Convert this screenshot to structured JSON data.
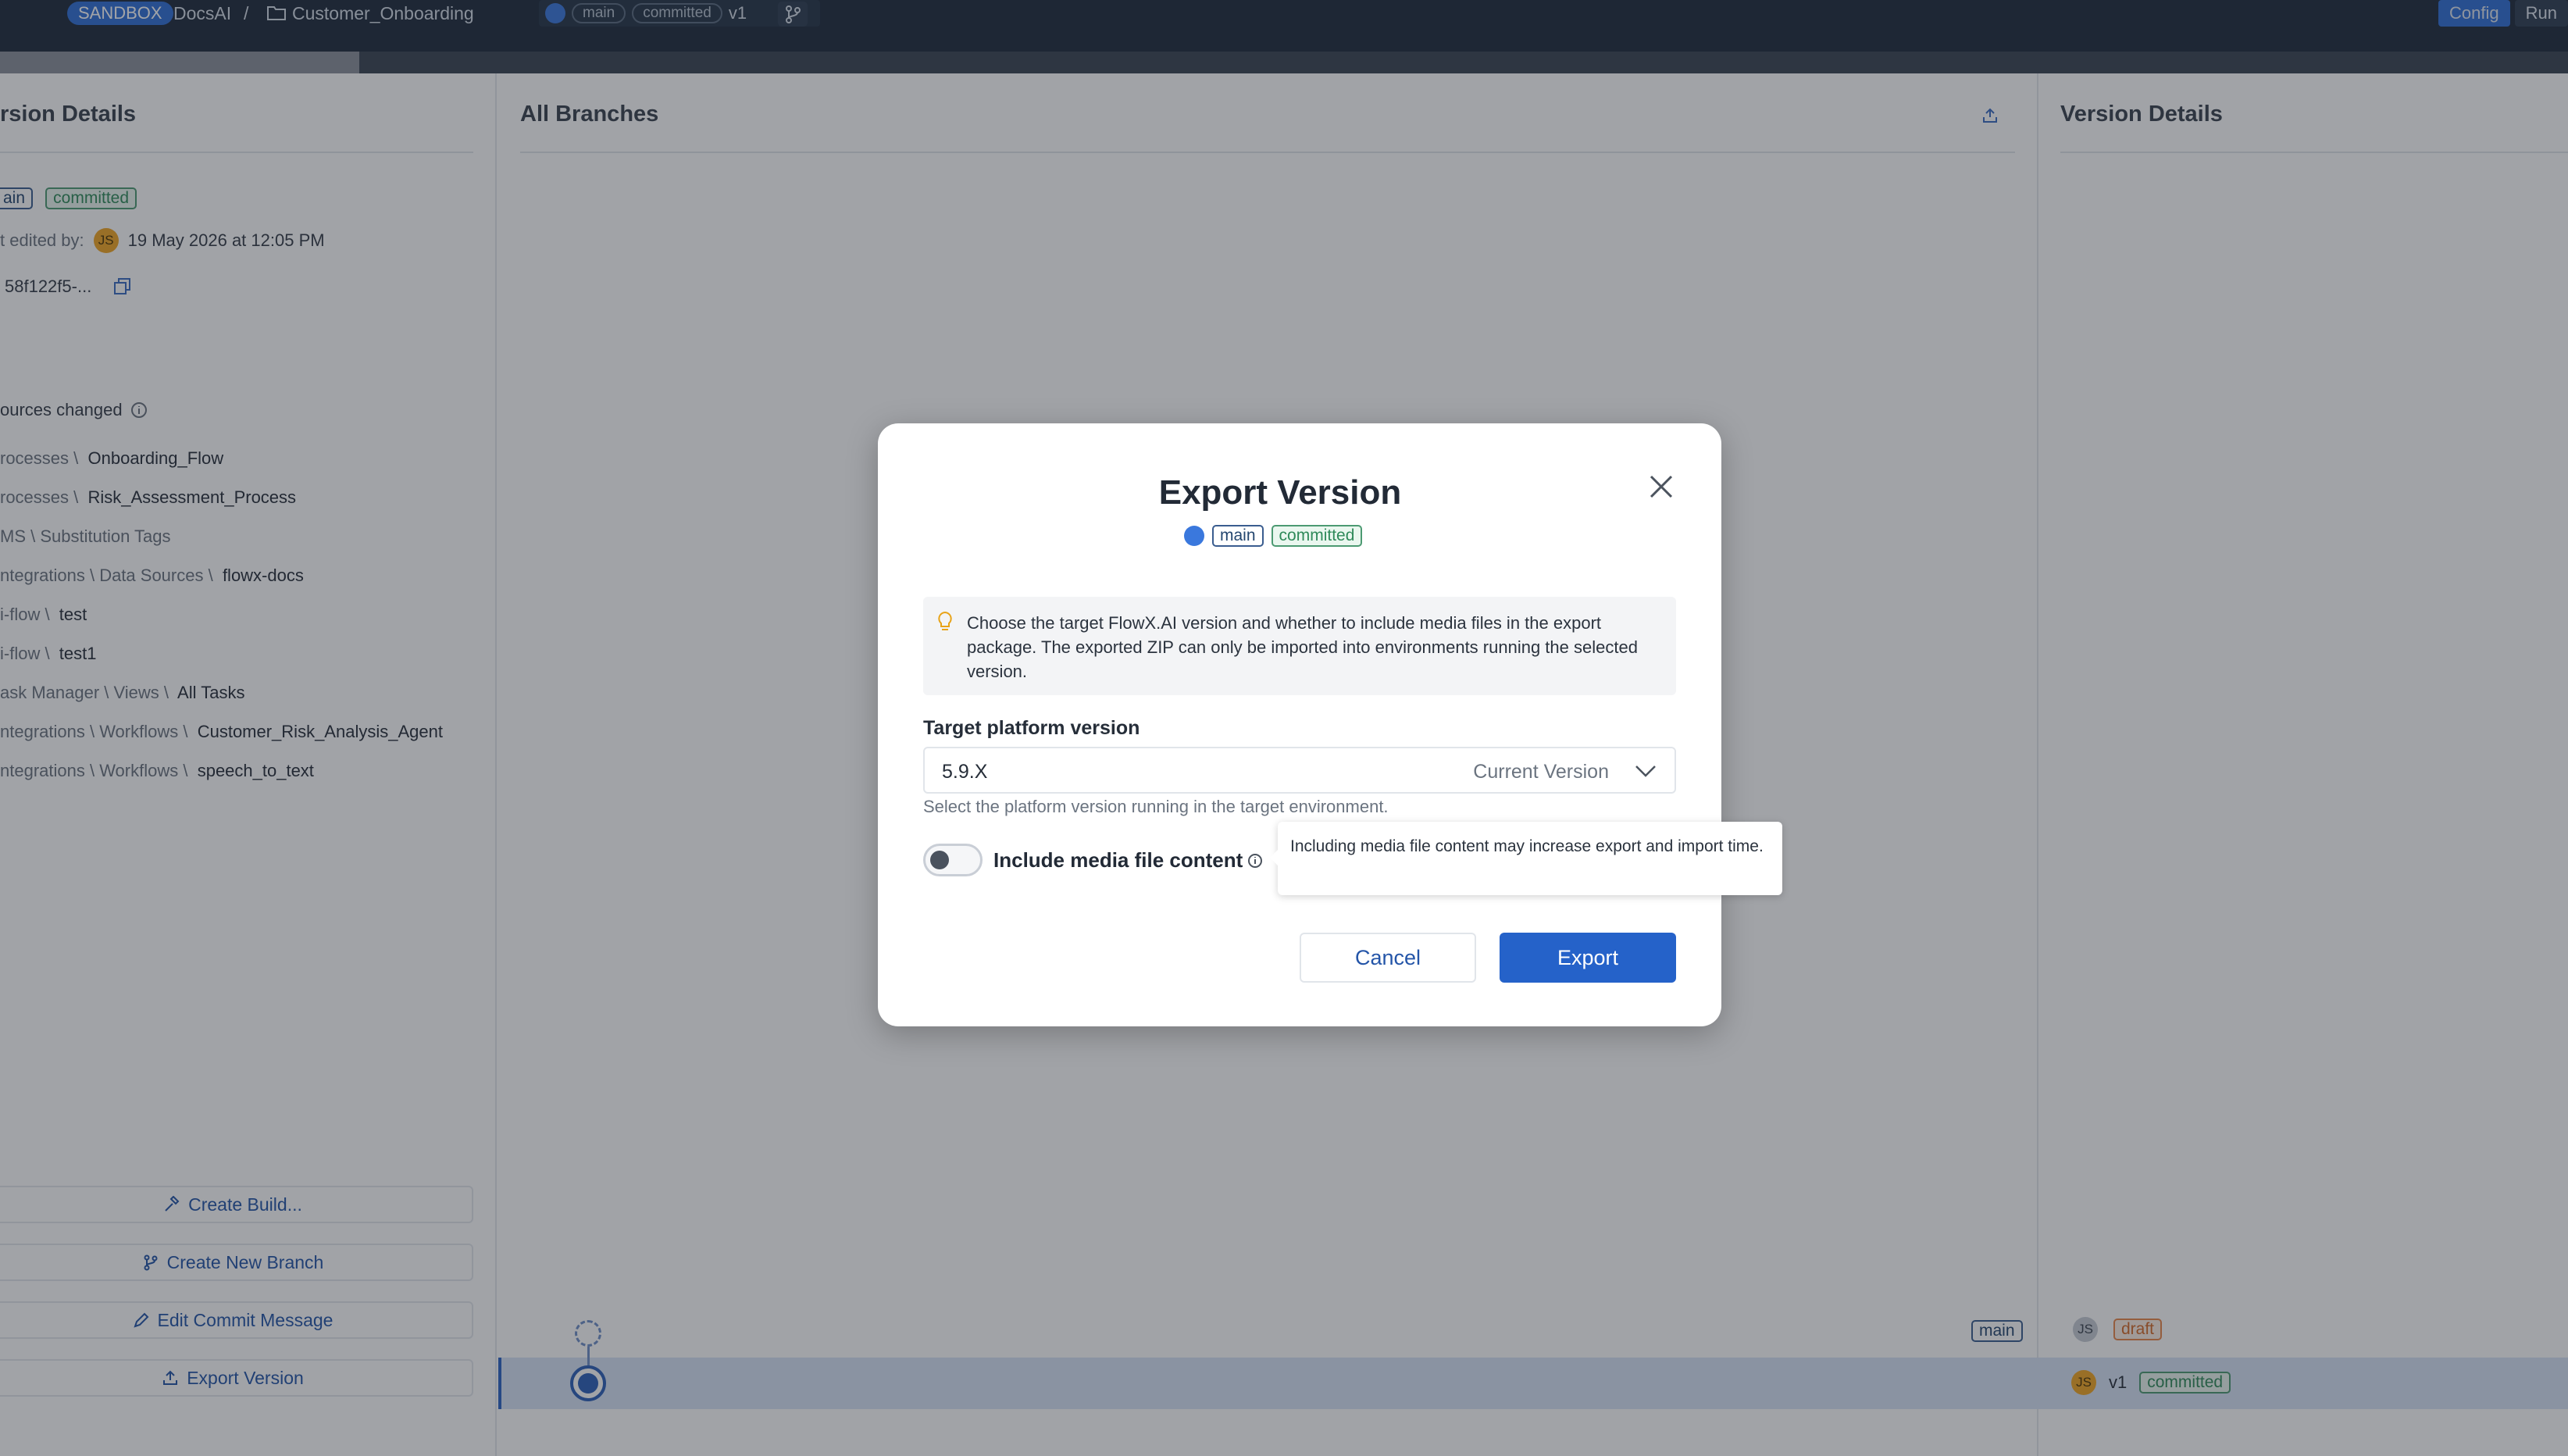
{
  "topbar": {
    "env_badge": "SANDBOX",
    "project": "DocsAI",
    "separator": "/",
    "workspace": "Customer_Onboarding",
    "branch_tag": "main",
    "status_tag": "committed",
    "version": "v1",
    "right_buttons": [
      "Config",
      "Run"
    ]
  },
  "left_panel": {
    "title": "rsion Details",
    "branch_tag": "ain",
    "status_tag": "committed",
    "edited_by_label": "t edited by:",
    "editor_initials": "JS",
    "edited_at": "19 May 2026 at 12:05 PM",
    "commit_hash": "58f122f5-...",
    "resources_label": "ources changed",
    "resources": [
      {
        "path": "rocesses \\",
        "name": "Onboarding_Flow"
      },
      {
        "path": "rocesses \\",
        "name": "Risk_Assessment_Process"
      },
      {
        "path": "MS \\ Substitution Tags",
        "name": ""
      },
      {
        "path": "ntegrations \\ Data Sources \\",
        "name": "flowx-docs"
      },
      {
        "path": "i-flow \\",
        "name": "test"
      },
      {
        "path": "i-flow \\",
        "name": "test1"
      },
      {
        "path": "ask Manager \\ Views \\",
        "name": "All Tasks"
      },
      {
        "path": "ntegrations \\ Workflows \\",
        "name": "Customer_Risk_Analysis_Agent"
      },
      {
        "path": "ntegrations \\ Workflows \\",
        "name": "speech_to_text"
      }
    ],
    "actions": [
      "Create Build...",
      "Create New Branch",
      "Edit Commit Message",
      "Export Version"
    ]
  },
  "middle_panel": {
    "title": "All Branches",
    "graph_branch_tag": "main"
  },
  "right_panel": {
    "title": "Version Details",
    "rows": [
      {
        "initials": "JS",
        "version": "",
        "status": "draft"
      },
      {
        "initials": "JS",
        "version": "v1",
        "status": "committed"
      }
    ]
  },
  "modal": {
    "title": "Export Version",
    "branch_tag": "main",
    "status_tag": "committed",
    "info_text": "Choose the target FlowX.AI version and whether to include media files in the export package. The exported ZIP can only be imported into environments running the selected version.",
    "target_label": "Target platform version",
    "target_value": "5.9.X",
    "target_hint": "Current Version",
    "helper_text": "Select the platform version running in the target environment.",
    "toggle_label": "Include media file content",
    "toggle_on": false,
    "tooltip": "Including media file content may increase export and import time.",
    "cancel_label": "Cancel",
    "export_label": "Export"
  },
  "colors": {
    "primary": "#2562c9",
    "topbar": "#1e2a3b",
    "committed": "#2f8a5a",
    "draft": "#d46a28"
  }
}
